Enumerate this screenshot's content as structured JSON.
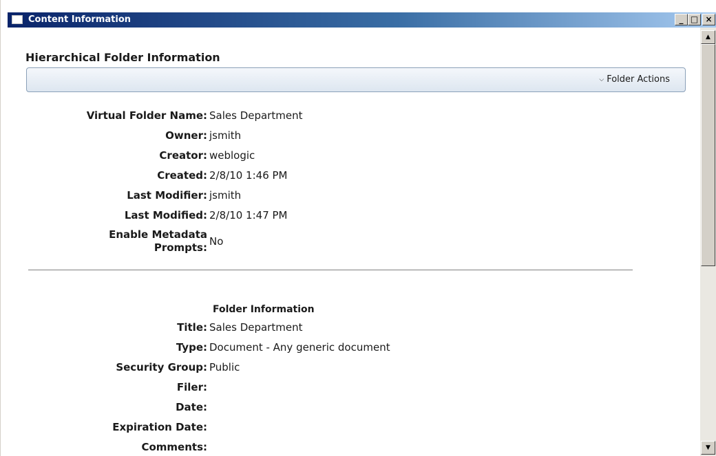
{
  "window": {
    "title": "Content Information",
    "minimize_label": "_",
    "maximize_label": "□",
    "close_label": "×"
  },
  "section": {
    "heading": "Hierarchical Folder Information",
    "folder_actions_label": "Folder Actions",
    "folder_actions_icon": "chevron-down-icon"
  },
  "folder_fields": [
    {
      "label": "Virtual Folder Name:",
      "value": "Sales Department"
    },
    {
      "label": "Owner:",
      "value": "jsmith"
    },
    {
      "label": "Creator:",
      "value": "weblogic"
    },
    {
      "label": "Created:",
      "value": "2/8/10 1:46 PM"
    },
    {
      "label": "Last Modifier:",
      "value": "jsmith"
    },
    {
      "label": "Last Modified:",
      "value": "2/8/10 1:47 PM"
    },
    {
      "label_line1": "Enable Metadata",
      "label_line2": "Prompts:",
      "value": "No"
    }
  ],
  "info": {
    "subheading": "Folder Information",
    "fields": [
      {
        "label": "Title:",
        "value": "Sales Department"
      },
      {
        "label": "Type:",
        "value": "Document - Any generic document"
      },
      {
        "label": "Security Group:",
        "value": "Public"
      },
      {
        "label": "Filer:",
        "value": ""
      },
      {
        "label": "Date:",
        "value": ""
      },
      {
        "label": "Expiration Date:",
        "value": ""
      },
      {
        "label": "Comments:",
        "value": ""
      }
    ]
  },
  "colors": {
    "titlebar_start": "#0a246a",
    "titlebar_end": "#a6caf0",
    "actions_bar": "#dde6f0"
  }
}
